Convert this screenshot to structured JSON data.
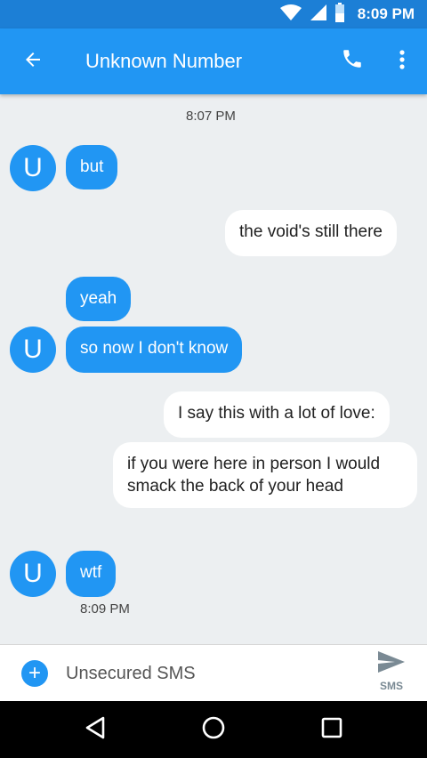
{
  "status_bar": {
    "time": "8:09 PM"
  },
  "app_bar": {
    "title": "Unknown Number"
  },
  "conversation": {
    "start_timestamp": "8:07 PM",
    "end_timestamp": "8:09 PM",
    "messages": [
      {
        "direction": "incoming",
        "avatar": "U",
        "text": "but"
      },
      {
        "direction": "outgoing",
        "text": "the void's still there"
      },
      {
        "direction": "incoming",
        "text": "yeah"
      },
      {
        "direction": "incoming",
        "avatar": "U",
        "text": "so now I don't know"
      },
      {
        "direction": "outgoing",
        "text": "I say this with a lot of love:"
      },
      {
        "direction": "outgoing",
        "text": "if you were here in person I would smack the back of your head"
      },
      {
        "direction": "incoming",
        "avatar": "U",
        "text": "wtf"
      }
    ]
  },
  "composer": {
    "placeholder": "Unsecured SMS",
    "send_label": "SMS"
  },
  "icons": {
    "back": "arrow-left-icon",
    "call": "phone-icon",
    "more": "more-vert-icon",
    "add": "plus-icon",
    "send": "send-icon",
    "nav_back": "triangle-back-icon",
    "nav_home": "circle-home-icon",
    "nav_recent": "square-recent-icon"
  },
  "colors": {
    "accent": "#2196f3",
    "status_bar": "#1c7fd6",
    "background": "#eceff1"
  }
}
